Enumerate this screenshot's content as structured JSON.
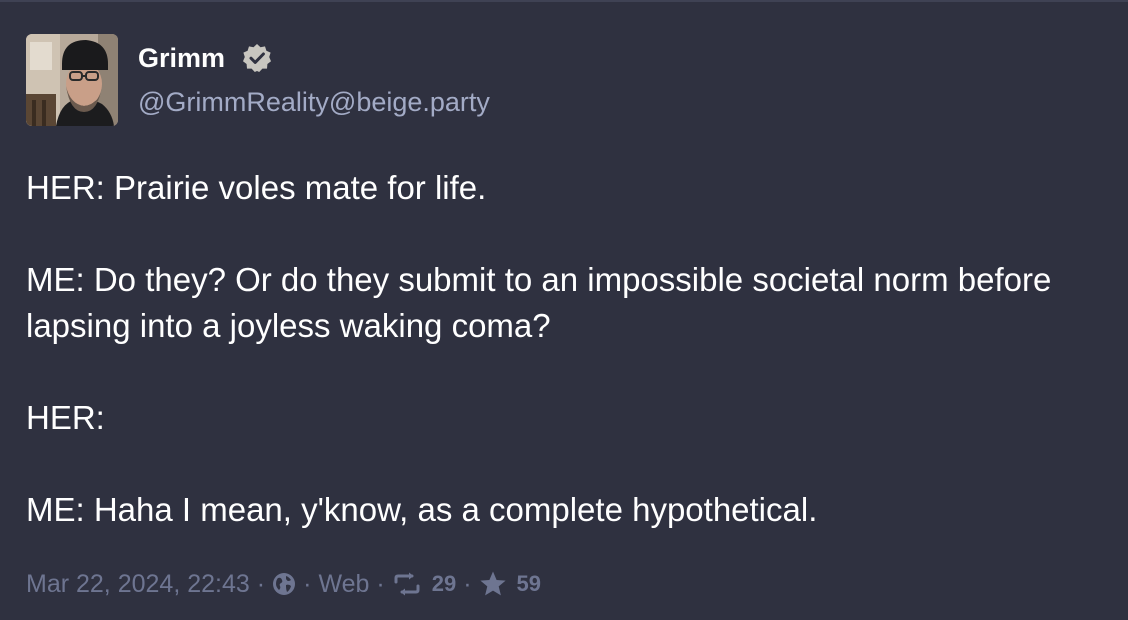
{
  "author": {
    "display_name": "Grimm",
    "handle": "@GrimmReality@beige.party",
    "verified_icon": "verified-check-icon",
    "avatar_icon": "avatar-photo"
  },
  "post": {
    "paragraphs": [
      "HER: Prairie voles mate for life.",
      "ME: Do they? Or do they submit to an impossible societal norm before lapsing into a joyless waking coma?",
      "HER:",
      "ME: Haha I mean, y'know, as a complete hypothetical."
    ]
  },
  "meta": {
    "timestamp": "Mar 22, 2024, 22:43",
    "separator": "·",
    "visibility_icon": "globe-icon",
    "client": "Web",
    "boost_icon": "boost-icon",
    "boost_count": "29",
    "favourite_icon": "star-icon",
    "favourite_count": "59"
  },
  "colors": {
    "background": "#2f3140",
    "text": "#ffffff",
    "handle": "#a3abc6",
    "meta": "#6e7591",
    "verified_badge": "#c8c6c0"
  }
}
